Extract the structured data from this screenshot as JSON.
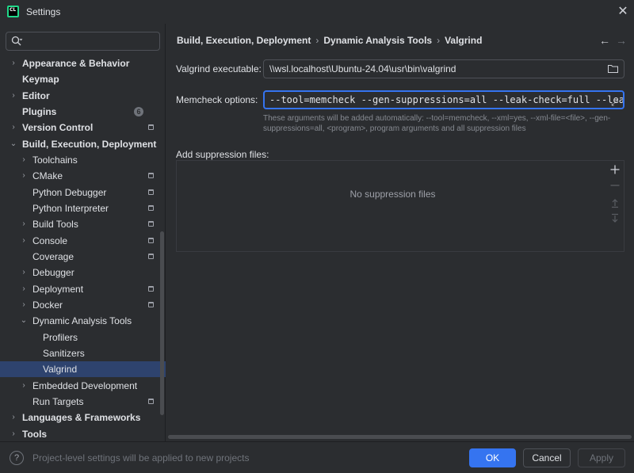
{
  "window": {
    "title": "Settings",
    "app_icon_text": "CL",
    "close_glyph": "✕"
  },
  "search": {
    "placeholder": "",
    "icon": "search-icon"
  },
  "tree": [
    {
      "label": "Appearance & Behavior",
      "chevron": "›",
      "bold": true,
      "level": 0
    },
    {
      "label": "Keymap",
      "chevron": "",
      "bold": true,
      "level": 0
    },
    {
      "label": "Editor",
      "chevron": "›",
      "bold": true,
      "level": 0
    },
    {
      "label": "Plugins",
      "chevron": "",
      "bold": true,
      "level": 0,
      "badge": "6"
    },
    {
      "label": "Version Control",
      "chevron": "›",
      "bold": true,
      "level": 0,
      "project": true
    },
    {
      "label": "Build, Execution, Deployment",
      "chevron": "⌄",
      "bold": true,
      "level": 0
    },
    {
      "label": "Toolchains",
      "chevron": "›",
      "bold": false,
      "level": 1
    },
    {
      "label": "CMake",
      "chevron": "›",
      "bold": false,
      "level": 1,
      "project": true
    },
    {
      "label": "Python Debugger",
      "chevron": "",
      "bold": false,
      "level": 1,
      "project": true
    },
    {
      "label": "Python Interpreter",
      "chevron": "",
      "bold": false,
      "level": 1,
      "project": true
    },
    {
      "label": "Build Tools",
      "chevron": "›",
      "bold": false,
      "level": 1,
      "project": true
    },
    {
      "label": "Console",
      "chevron": "›",
      "bold": false,
      "level": 1,
      "project": true
    },
    {
      "label": "Coverage",
      "chevron": "",
      "bold": false,
      "level": 1,
      "project": true
    },
    {
      "label": "Debugger",
      "chevron": "›",
      "bold": false,
      "level": 1
    },
    {
      "label": "Deployment",
      "chevron": "›",
      "bold": false,
      "level": 1,
      "project": true
    },
    {
      "label": "Docker",
      "chevron": "›",
      "bold": false,
      "level": 1,
      "project": true
    },
    {
      "label": "Dynamic Analysis Tools",
      "chevron": "⌄",
      "bold": false,
      "level": 1
    },
    {
      "label": "Profilers",
      "chevron": "",
      "bold": false,
      "level": 2
    },
    {
      "label": "Sanitizers",
      "chevron": "",
      "bold": false,
      "level": 2
    },
    {
      "label": "Valgrind",
      "chevron": "",
      "bold": false,
      "level": 2,
      "selected": true
    },
    {
      "label": "Embedded Development",
      "chevron": "›",
      "bold": false,
      "level": 1
    },
    {
      "label": "Run Targets",
      "chevron": "",
      "bold": false,
      "level": 1,
      "project": true
    },
    {
      "label": "Languages & Frameworks",
      "chevron": "›",
      "bold": true,
      "level": 0
    },
    {
      "label": "Tools",
      "chevron": "›",
      "bold": true,
      "level": 0
    }
  ],
  "breadcrumb": {
    "items": [
      "Build, Execution, Deployment",
      "Dynamic Analysis Tools",
      "Valgrind"
    ],
    "separator": "›",
    "back_glyph": "←",
    "forward_glyph": "→"
  },
  "form": {
    "valgrind_label": "Valgrind executable:",
    "valgrind_value": "\\\\wsl.localhost\\Ubuntu-24.04\\usr\\bin\\valgrind",
    "memcheck_label": "Memcheck options:",
    "memcheck_value": "--tool=memcheck --gen-suppressions=all --leak-check=full --leak-r",
    "hint": "These arguments will be added automatically: --tool=memcheck, --xml=yes, --xml-file=<file>, --gen-suppressions=all, <program>, program arguments and all suppression files",
    "suppression_label": "Add suppression files:",
    "suppression_empty": "No suppression files",
    "expand_glyph": "⤢"
  },
  "footer": {
    "help_glyph": "?",
    "note": "Project-level settings will be applied to new projects",
    "ok": "OK",
    "cancel": "Cancel",
    "apply": "Apply"
  },
  "colors": {
    "background": "#2b2d30",
    "accent": "#3574f0",
    "selection": "#2e436e",
    "logo": "#21d789"
  }
}
